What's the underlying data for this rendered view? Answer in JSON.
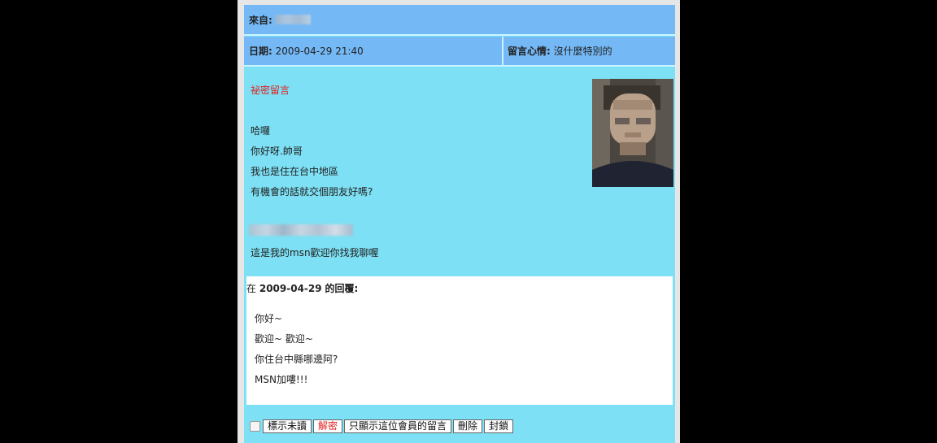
{
  "header": {
    "from_label": "來自:",
    "date_label": "日期:",
    "date_value": "2009-04-29 21:40",
    "mood_label": "留言心情:",
    "mood_value": "沒什麼特別的"
  },
  "message": {
    "secret_tag": "祕密留言",
    "lines": [
      "哈囉",
      "你好呀.帥哥",
      "我也是住在台中地區",
      "有機會的話就交個朋友好嗎?"
    ],
    "msn_line": "這是我的msn歡迎你找我聊喔"
  },
  "reply": {
    "prefix": "在",
    "date": "2009-04-29",
    "suffix": "的回覆:",
    "lines": [
      "你好~",
      "歡迎~ 歡迎~",
      "你住台中縣哪邊阿?",
      "MSN加嘍!!!"
    ]
  },
  "actions": {
    "mark_unread": "標示未讀",
    "decrypt": "解密",
    "show_member_only": "只顯示這位會員的留言",
    "delete": "刪除",
    "block": "封鎖"
  },
  "colors": {
    "header_bg": "#74b8f6",
    "body_bg": "#7de0f4",
    "secret_text": "#e12020"
  }
}
